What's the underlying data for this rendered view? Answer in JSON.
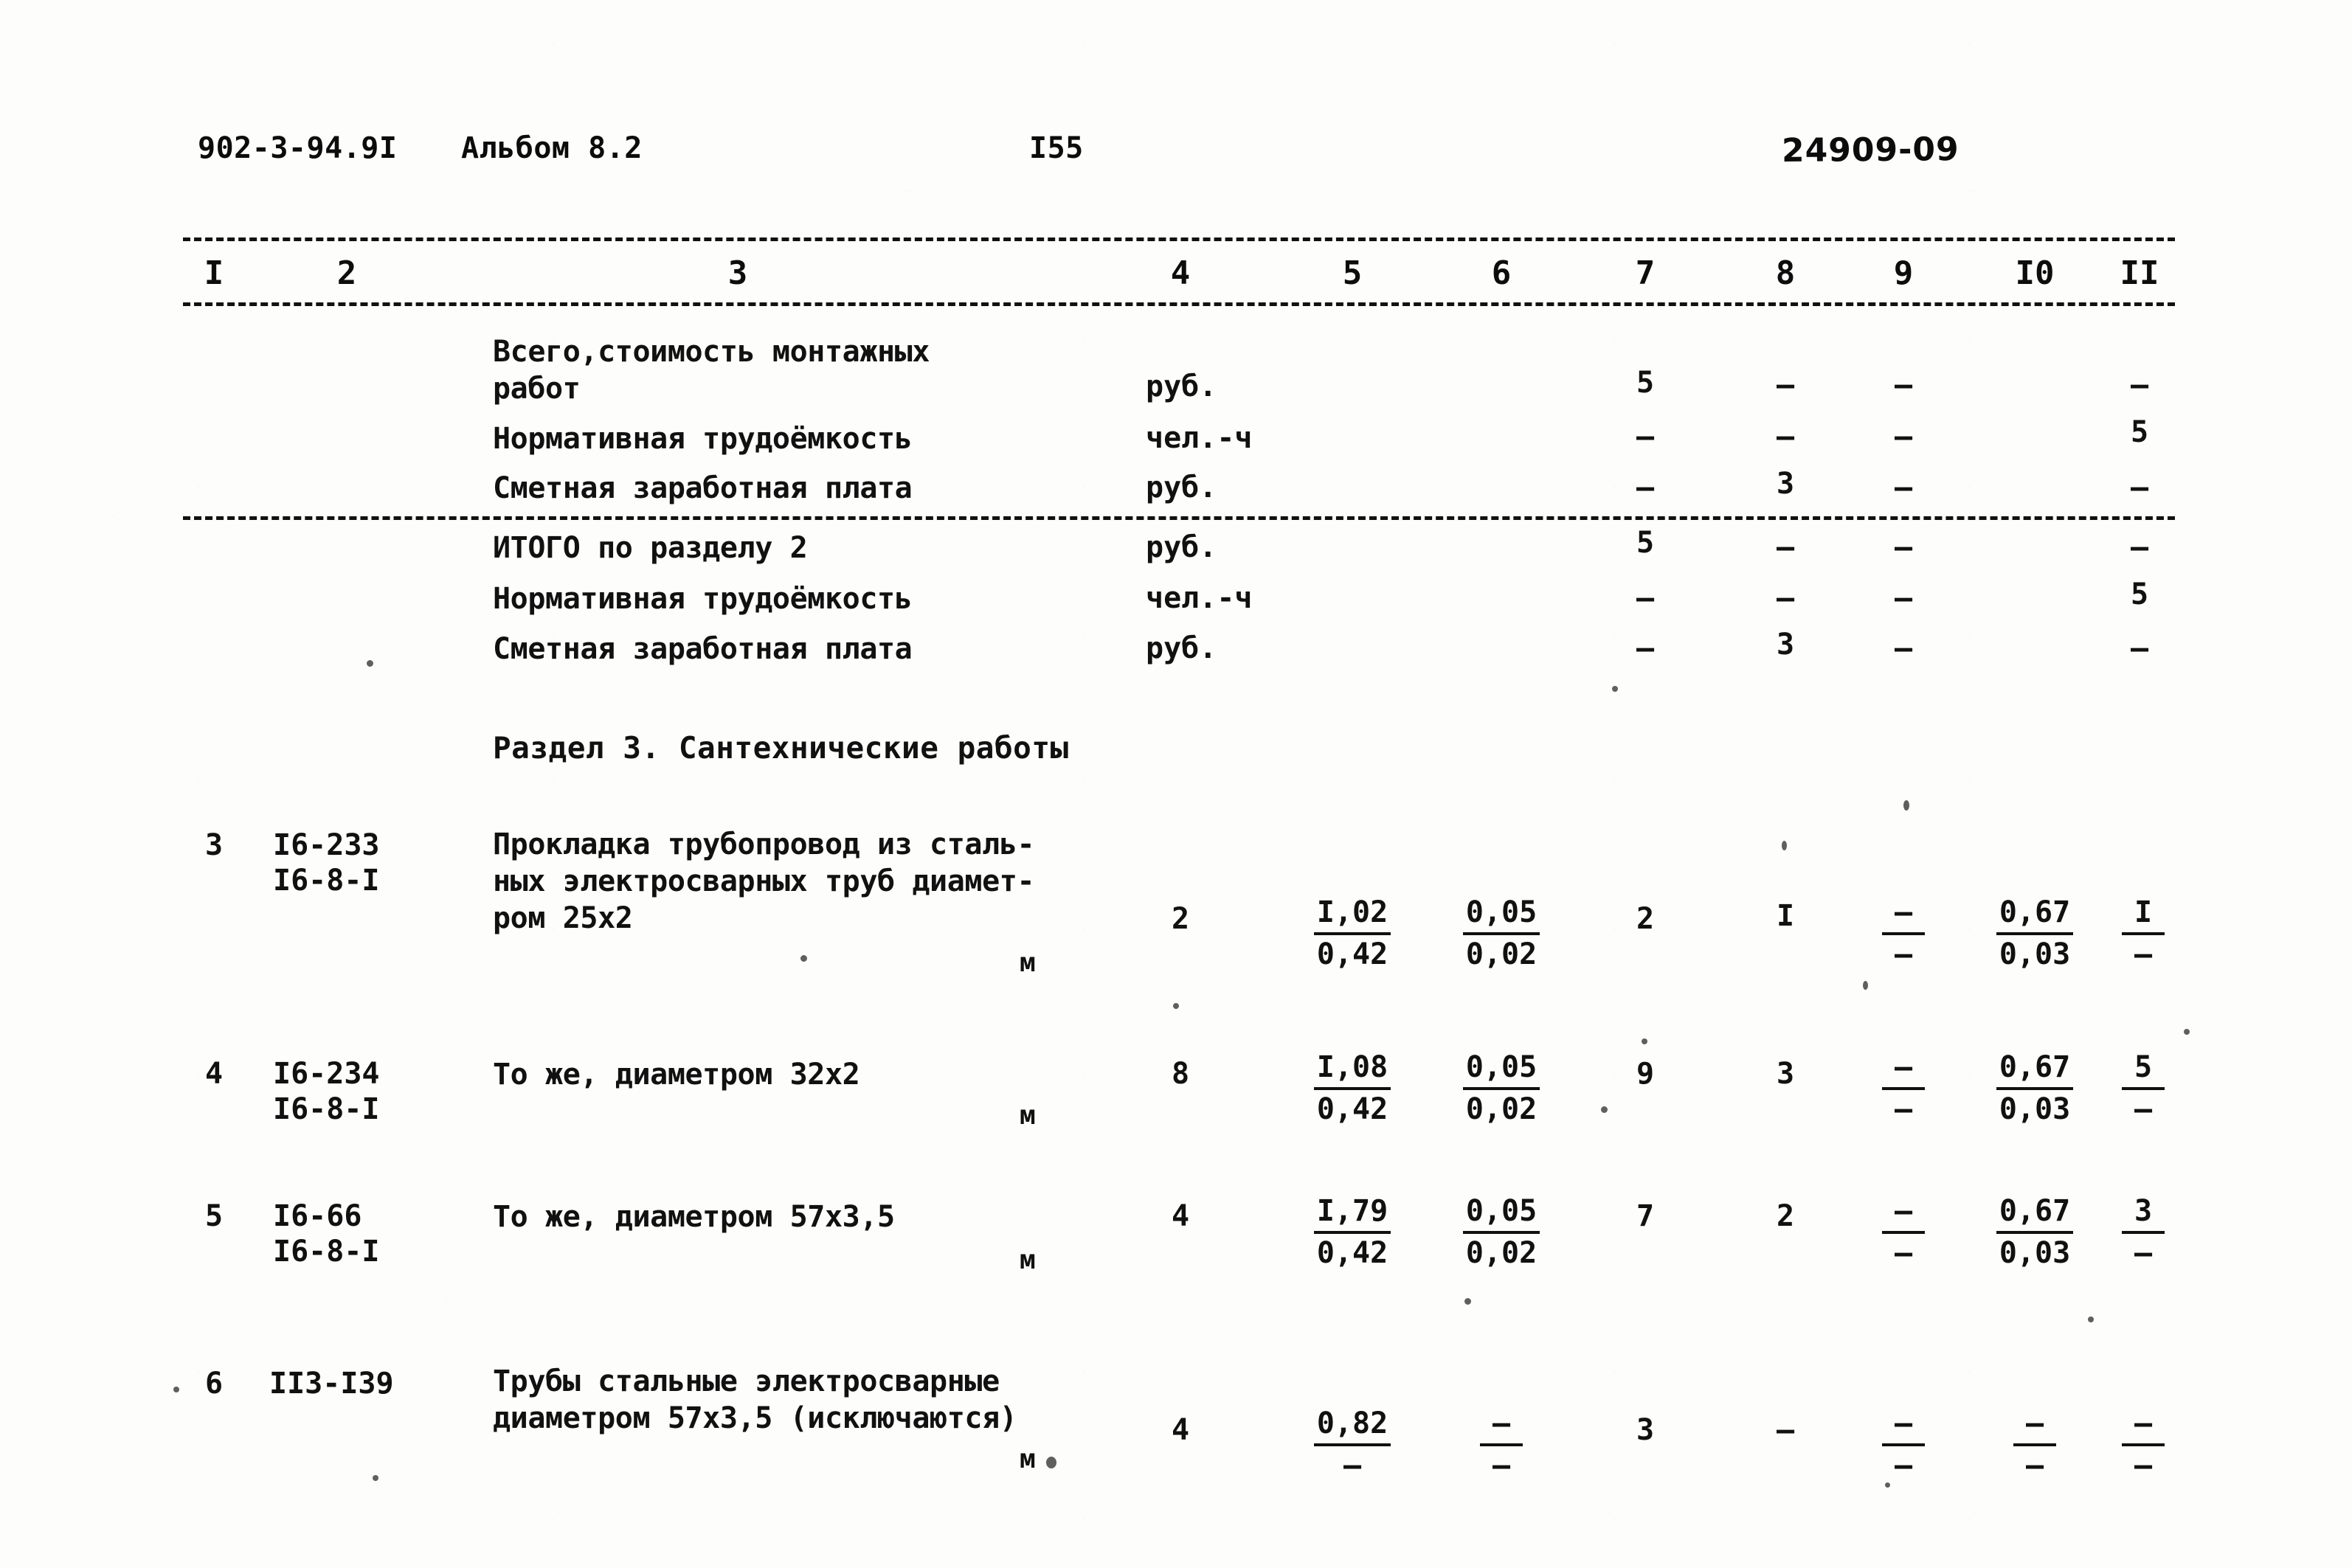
{
  "header": {
    "doc_number": "902-3-94.9I",
    "album": "Альбом 8.2",
    "page_number": "I55",
    "archive_code": "24909-09"
  },
  "table": {
    "column_numbers": [
      "I",
      "2",
      "3",
      "4",
      "5",
      "6",
      "7",
      "8",
      "9",
      "I0",
      "II"
    ],
    "summary_block_1": [
      {
        "description": "Всего,стоимость монтажных\nработ",
        "unit": "руб.",
        "c4": "",
        "c5": "",
        "c6": "",
        "c7": "5",
        "c8": "–",
        "c9": "–",
        "c10": "",
        "c11": "–"
      },
      {
        "description": "Нормативная трудоёмкость",
        "unit": "чел.-ч",
        "c4": "",
        "c5": "",
        "c6": "",
        "c7": "–",
        "c8": "–",
        "c9": "–",
        "c10": "",
        "c11": "5"
      },
      {
        "description": "Сметная заработная плата",
        "unit": "руб.",
        "c4": "",
        "c5": "",
        "c6": "",
        "c7": "–",
        "c8": "3",
        "c9": "–",
        "c10": "",
        "c11": "–"
      }
    ],
    "summary_block_2": [
      {
        "description": "ИТОГО по разделу 2",
        "unit": "руб.",
        "c4": "",
        "c5": "",
        "c6": "",
        "c7": "5",
        "c8": "–",
        "c9": "–",
        "c10": "",
        "c11": "–"
      },
      {
        "description": "Нормативная трудоёмкость",
        "unit": "чел.-ч",
        "c4": "",
        "c5": "",
        "c6": "",
        "c7": "–",
        "c8": "–",
        "c9": "–",
        "c10": "",
        "c11": "5"
      },
      {
        "description": "Сметная заработная плата",
        "unit": "руб.",
        "c4": "",
        "c5": "",
        "c6": "",
        "c7": "–",
        "c8": "3",
        "c9": "–",
        "c10": "",
        "c11": "–"
      }
    ],
    "section_title": "Раздел 3. Сантехнические работы",
    "items": [
      {
        "no": "3",
        "code_line_1": "I6-233",
        "code_line_2": "I6-8-I",
        "description": "Прокладка трубопровод из сталь-\nных электросварных труб диамет-\nром 25х2",
        "unit": "м",
        "c4": "2",
        "c5_num": "I,02",
        "c5_den": "0,42",
        "c6_num": "0,05",
        "c6_den": "0,02",
        "c7": "2",
        "c8": "I",
        "c9_num": "–",
        "c9_den": "–",
        "c10_num": "0,67",
        "c10_den": "0,03",
        "c11_num": "I",
        "c11_den": "–"
      },
      {
        "no": "4",
        "code_line_1": "I6-234",
        "code_line_2": "I6-8-I",
        "description": "То же, диаметром 32х2",
        "unit": "м",
        "c4": "8",
        "c5_num": "I,08",
        "c5_den": "0,42",
        "c6_num": "0,05",
        "c6_den": "0,02",
        "c7": "9",
        "c8": "3",
        "c9_num": "–",
        "c9_den": "–",
        "c10_num": "0,67",
        "c10_den": "0,03",
        "c11_num": "5",
        "c11_den": "–"
      },
      {
        "no": "5",
        "code_line_1": "I6-66",
        "code_line_2": "I6-8-I",
        "description": "То же, диаметром 57х3,5",
        "unit": "м",
        "c4": "4",
        "c5_num": "I,79",
        "c5_den": "0,42",
        "c6_num": "0,05",
        "c6_den": "0,02",
        "c7": "7",
        "c8": "2",
        "c9_num": "–",
        "c9_den": "–",
        "c10_num": "0,67",
        "c10_den": "0,03",
        "c11_num": "3",
        "c11_den": "–"
      },
      {
        "no": "6",
        "code_line_1": "II3-I39",
        "code_line_2": "",
        "description": "Трубы стальные электросварные\nдиаметром 57х3,5 (исключаются)",
        "unit": "м",
        "c4": "4",
        "c5_num": "0,82",
        "c5_den": "–",
        "c6_num": "–",
        "c6_den": "–",
        "c7": "3",
        "c8": "–",
        "c9_num": "–",
        "c9_den": "–",
        "c10_num": "–",
        "c10_den": "–",
        "c11_num": "–",
        "c11_den": "–"
      }
    ]
  }
}
